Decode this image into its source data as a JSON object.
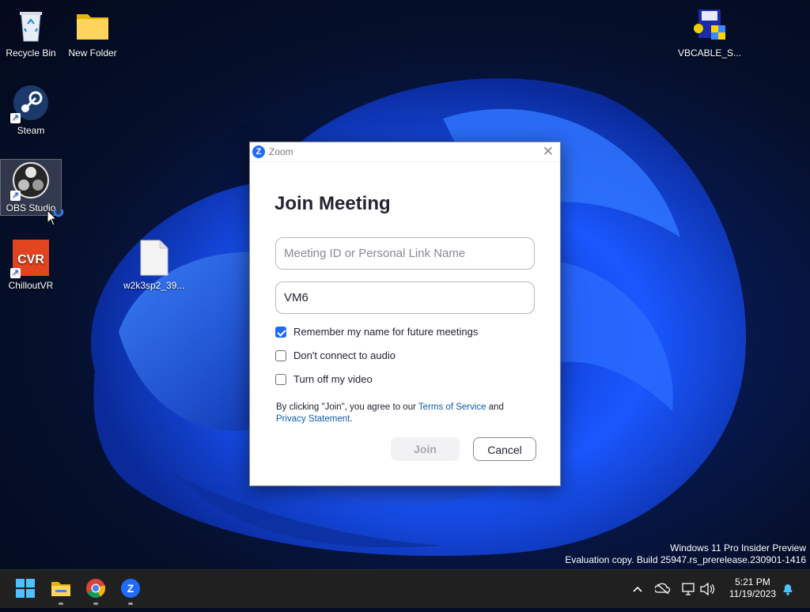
{
  "desktop": {
    "icons": [
      {
        "label": "Recycle Bin"
      },
      {
        "label": "New Folder"
      },
      {
        "label": "Steam"
      },
      {
        "label": "OBS Studio"
      },
      {
        "label": "ChilloutVR"
      },
      {
        "label": "w2k3sp2_39..."
      },
      {
        "label": "VBCABLE_S..."
      }
    ],
    "watermark": {
      "line1": "Windows 11 Pro Insider Preview",
      "line2": "Evaluation copy. Build 25947.rs_prerelease.230901-1416"
    }
  },
  "dialog": {
    "window_title": "Zoom",
    "heading": "Join Meeting",
    "meeting_id_placeholder": "Meeting ID or Personal Link Name",
    "meeting_id_value": "",
    "name_value": "VM6",
    "options": [
      {
        "label": "Remember my name for future meetings",
        "checked": true
      },
      {
        "label": "Don't connect to audio",
        "checked": false
      },
      {
        "label": "Turn off my video",
        "checked": false
      }
    ],
    "legal": {
      "prefix": "By clicking \"Join\", you agree to our ",
      "terms": "Terms of Service",
      "and": " and",
      "privacy": "Privacy Statement",
      "suffix": "."
    },
    "join_label": "Join",
    "cancel_label": "Cancel"
  },
  "taskbar": {
    "apps": [
      "start-icon",
      "file-explorer-icon",
      "chrome-icon",
      "zoom-icon"
    ],
    "time": "5:21 PM",
    "date": "11/19/2023"
  },
  "colors": {
    "accent": "#1f6bff",
    "link": "#0e5ca8"
  }
}
